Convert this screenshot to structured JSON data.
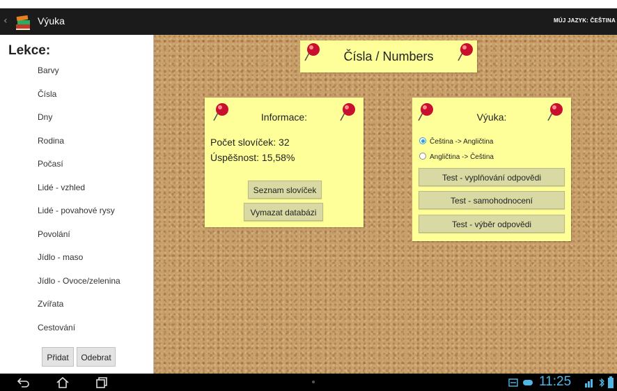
{
  "actionbar": {
    "title": "Výuka",
    "language": "MÚJ JAZYK: ČEŠTINA",
    "app_icon": "books-icon"
  },
  "sidebar": {
    "heading": "Lekce:",
    "lessons": [
      "Barvy",
      "Čísla",
      "Dny",
      "Rodina",
      "Počasí",
      "Lidé - vzhled",
      "Lidé - povahové rysy",
      "Povolání",
      "Jídlo - maso",
      "Jídlo - Ovoce/zelenina",
      "Zvířata",
      "Cestování"
    ],
    "add_label": "Přidat",
    "remove_label": "Odebrat"
  },
  "board": {
    "title": "Čísla / Numbers",
    "info": {
      "title": "Informace:",
      "word_count": "Počet slovíček: 32",
      "success": "Úspěšnost: 15,58%",
      "list_button": "Seznam slovíček",
      "delete_button": "Vymazat databázi"
    },
    "learning": {
      "title": "Výuka:",
      "direction_options": [
        "Čeština -> Angličtina",
        "Angličtina -> Čeština"
      ],
      "selected_direction": "Čeština -> Angličtina",
      "test_buttons": [
        "Test - vyplňování odpovědi",
        "Test - samohodnocení",
        "Test - výběr odpovědi"
      ]
    }
  },
  "statusbar": {
    "time": "11:25"
  },
  "colors": {
    "note": "#ffff9a",
    "cork": "#c89e69",
    "clock": "#4fb7e6",
    "pin": "#c8102e",
    "radio_accent": "#2d9bd8"
  }
}
